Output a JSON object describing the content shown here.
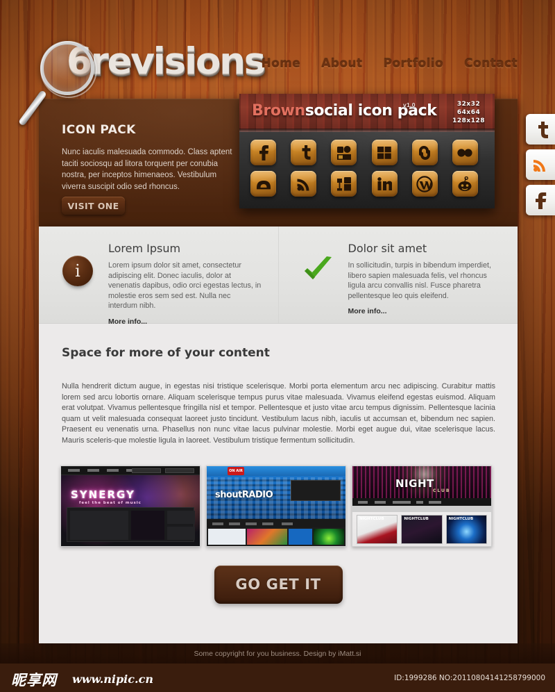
{
  "site": {
    "logo_text": "6revisions",
    "nav": [
      {
        "label": "Home"
      },
      {
        "label": "About"
      },
      {
        "label": "Portfolio"
      },
      {
        "label": "Contact"
      }
    ]
  },
  "social_tabs": [
    {
      "name": "twitter",
      "label": "Twitter",
      "color": "#5a3015"
    },
    {
      "name": "rss",
      "label": "RSS",
      "color": "#f07818"
    },
    {
      "name": "facebook",
      "label": "Facebook",
      "color": "#5a3015"
    }
  ],
  "promo": {
    "title": "ICON PACK",
    "text": "Nunc iaculis malesuada commodo. Class aptent taciti sociosqu ad litora torquent per conubia nostra, per inceptos himenaeos. Vestibulum viverra suscipit odio sed rhoncus.",
    "button_label": "VISIT ONE"
  },
  "icon_pack": {
    "brand_word": "Brown",
    "title_rest": "social icon pack",
    "version": "v1.0",
    "sizes": "32x32\n64x64\n128x128",
    "brand_color": "#e2705f",
    "icons": [
      {
        "name": "facebook-icon",
        "label": "Facebook"
      },
      {
        "name": "twitter-icon",
        "label": "Twitter"
      },
      {
        "name": "myspace-icon",
        "label": "MySpace"
      },
      {
        "name": "windows-icon",
        "label": "Windows"
      },
      {
        "name": "stumbleupon-icon",
        "label": "StumbleUpon"
      },
      {
        "name": "flickr-icon",
        "label": "Flickr"
      },
      {
        "name": "deviantart-icon",
        "label": "deviantART"
      },
      {
        "name": "rss-icon",
        "label": "RSS"
      },
      {
        "name": "mixx-icon",
        "label": "Mixx"
      },
      {
        "name": "linkedin-icon",
        "label": "LinkedIn"
      },
      {
        "name": "wordpress-icon",
        "label": "WordPress"
      },
      {
        "name": "reddit-icon",
        "label": "Reddit"
      }
    ]
  },
  "features": [
    {
      "icon": "info-icon",
      "title": "Lorem Ipsum",
      "text": "Lorem ipsum dolor sit amet, consectetur adipiscing elit. Donec iaculis, dolor at venenatis dapibus, odio orci egestas lectus, in molestie eros sem sed est. Nulla nec interdum nibh.",
      "link": "More info..."
    },
    {
      "icon": "check-icon",
      "title": "Dolor sit amet",
      "text": "In sollicitudin, turpis in bibendum imperdiet, libero sapien malesuada felis, vel rhoncus ligula arcu convallis nisl. Fusce pharetra pellentesque leo quis eleifend.",
      "link": "More info..."
    }
  ],
  "main": {
    "title": "Space for more of your content",
    "body": "Nulla hendrerit dictum augue, in egestas nisi tristique scelerisque. Morbi porta elementum arcu nec adipiscing. Curabitur mattis lorem sed arcu lobortis ornare. Aliquam scelerisque tempus purus vitae malesuada. Vivamus eleifend egestas euismod. Aliquam erat volutpat. Vivamus pellentesque fringilla nisl et tempor. Pellentesque et justo vitae arcu tempus dignissim. Pellentesque lacinia quam ut velit malesuada consequat laoreet justo tincidunt. Vestibulum lacus nibh, iaculis ut accumsan et, bibendum nec sapien. Praesent eu venenatis urna. Phasellus non nunc vitae lacus pulvinar molestie. Morbi eget augue dui, vitae scelerisque lacus. Mauris sceleris-que molestie ligula in laoreet. Vestibulum tristique fermentum sollicitudin.",
    "cta_label": "GO GET IT"
  },
  "thumbnails": [
    {
      "name": "synergy",
      "label": "SYNERGY",
      "sublabel": "feel the beat of music"
    },
    {
      "name": "shout-radio",
      "label": "shoutRADIO",
      "badge": "ON AIR"
    },
    {
      "name": "night-club",
      "label": "NIGHT",
      "sublabel": "CLUB",
      "cards": [
        "NIGHTCLUB",
        "NIGHTCLUB",
        "NIGHTCLUB"
      ]
    }
  ],
  "footer": {
    "copyright": "Some copyright for you business. Design by iMatt.si"
  },
  "watermark": {
    "cn_name": "昵享网",
    "url": "www.nipic.cn",
    "id": "ID:1999286 NO:20110804141258799000"
  }
}
